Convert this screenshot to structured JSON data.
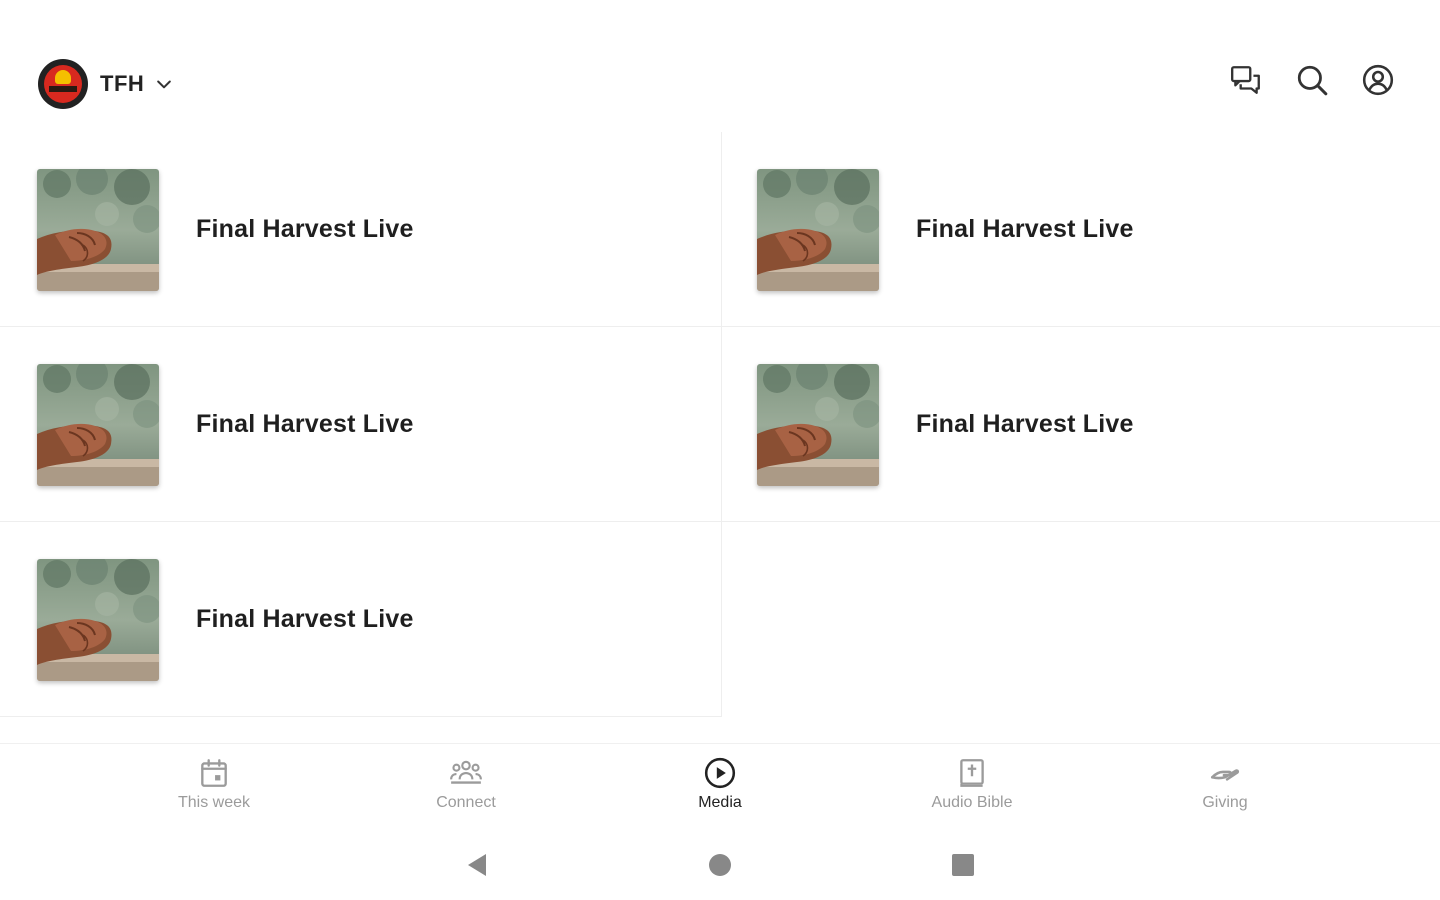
{
  "header": {
    "church_name": "TFH"
  },
  "icons": {
    "church_logo": "church-logo",
    "switcher": "chevron-down-icon",
    "messages": "chat-bubbles-icon",
    "search": "search-icon",
    "profile": "account-circle-icon"
  },
  "media": {
    "items": [
      {
        "title": "Final Harvest Live"
      },
      {
        "title": "Final Harvest Live"
      },
      {
        "title": "Final Harvest Live"
      },
      {
        "title": "Final Harvest Live"
      },
      {
        "title": "Final Harvest Live"
      }
    ]
  },
  "tabs": [
    {
      "label": "This week",
      "icon": "calendar-icon",
      "active": false
    },
    {
      "label": "Connect",
      "icon": "group-icon",
      "active": false
    },
    {
      "label": "Media",
      "icon": "play-circle-icon",
      "active": true
    },
    {
      "label": "Audio Bible",
      "icon": "bible-icon",
      "active": false
    },
    {
      "label": "Giving",
      "icon": "giving-hand-icon",
      "active": false
    }
  ],
  "colors": {
    "active_tab": "#222222",
    "inactive_tab": "#9b9b9b",
    "logo_red": "#d8291f",
    "logo_yellow": "#f5c000"
  }
}
